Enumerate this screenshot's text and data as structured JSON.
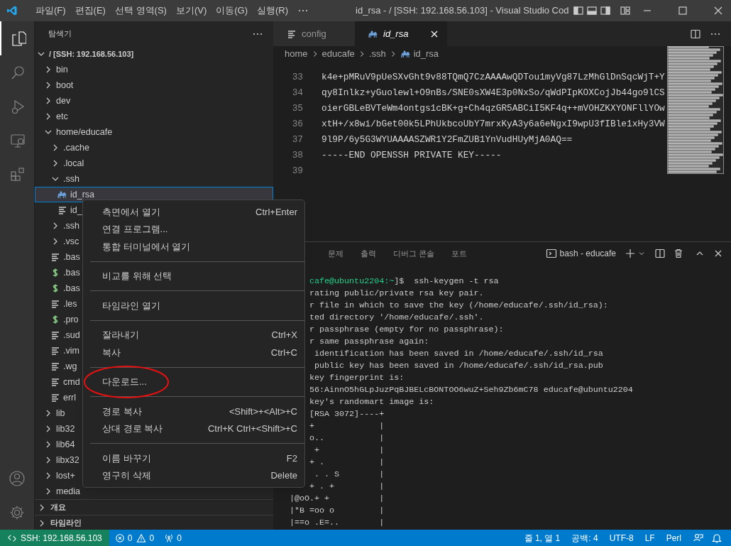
{
  "title_bar": {
    "menus": [
      "파일(F)",
      "편집(E)",
      "선택 영역(S)",
      "보기(V)",
      "이동(G)",
      "실행(R)"
    ],
    "title": "id_rsa - / [SSH: 192.168.56.103] - Visual Studio Cod"
  },
  "activity_bar": {
    "items": [
      {
        "kind": "explorer",
        "selected": true
      },
      {
        "kind": "search",
        "selected": false
      },
      {
        "kind": "run",
        "selected": false
      },
      {
        "kind": "remote",
        "selected": false
      },
      {
        "kind": "extensions",
        "selected": false
      }
    ]
  },
  "sidebar": {
    "title": "탐색기",
    "tree": [
      {
        "name": "/ [SSH: 192.168.56.103]",
        "kind": "root",
        "expanded": true,
        "selected": false,
        "children": [
          {
            "name": "bin",
            "kind": "folder",
            "expanded": false,
            "selected": false
          },
          {
            "name": "boot",
            "kind": "folder",
            "expanded": false,
            "selected": false
          },
          {
            "name": "dev",
            "kind": "folder",
            "expanded": false,
            "selected": false
          },
          {
            "name": "etc",
            "kind": "folder",
            "expanded": false,
            "selected": false
          },
          {
            "name": "home/educafe",
            "kind": "folder",
            "expanded": true,
            "selected": false,
            "children": [
              {
                "name": ".cache",
                "kind": "folder",
                "expanded": false,
                "selected": false
              },
              {
                "name": ".local",
                "kind": "folder",
                "expanded": false,
                "selected": false
              },
              {
                "name": ".ssh",
                "kind": "folder",
                "expanded": true,
                "selected": false,
                "children": [
                  {
                    "name": "id_rsa",
                    "kind": "key_file",
                    "selected": true
                  },
                  {
                    "name": "id_",
                    "kind": "text_file",
                    "selected": false
                  }
                ]
              },
              {
                "name": ".ssh",
                "kind": "folder",
                "expanded": false,
                "selected": false
              },
              {
                "name": ".vsc",
                "kind": "folder",
                "expanded": false,
                "selected": false
              },
              {
                "name": ".bas",
                "kind": "text_file",
                "selected": false
              },
              {
                "name": ".bas",
                "kind": "shell_file",
                "selected": false
              },
              {
                "name": ".bas",
                "kind": "shell_file",
                "selected": false
              },
              {
                "name": ".les",
                "kind": "text_file",
                "selected": false
              },
              {
                "name": ".pro",
                "kind": "shell_file",
                "selected": false
              },
              {
                "name": ".sud",
                "kind": "text_file",
                "selected": false
              },
              {
                "name": ".vim",
                "kind": "text_file",
                "selected": false
              },
              {
                "name": ".wg",
                "kind": "text_file",
                "selected": false
              },
              {
                "name": "cmd",
                "kind": "text_file",
                "selected": false
              },
              {
                "name": "errl",
                "kind": "text_file",
                "selected": false
              }
            ]
          },
          {
            "name": "lib",
            "kind": "folder",
            "expanded": false,
            "selected": false
          },
          {
            "name": "lib32",
            "kind": "folder",
            "expanded": false,
            "selected": false
          },
          {
            "name": "lib64",
            "kind": "folder",
            "expanded": false,
            "selected": false
          },
          {
            "name": "libx32",
            "kind": "folder",
            "expanded": false,
            "selected": false
          },
          {
            "name": "lost+",
            "kind": "folder",
            "expanded": false,
            "selected": false
          },
          {
            "name": "media",
            "kind": "folder",
            "expanded": false,
            "selected": false
          }
        ]
      }
    ],
    "sections": [
      {
        "label": "개요",
        "expanded": false
      },
      {
        "label": "타임라인",
        "expanded": false
      }
    ]
  },
  "editor": {
    "tabs": [
      {
        "label": "config",
        "kind": "text_file",
        "selected": false
      },
      {
        "label": "id_rsa",
        "kind": "key_file",
        "selected": true
      }
    ],
    "breadcrumb": [
      "home",
      "educafe",
      ".ssh",
      "id_rsa"
    ],
    "lines": [
      {
        "number": "33",
        "text": "k4e+pMRuV9pUeSXvGht9v88TQmQ7CzAAAAwQDTou1myVg87LzMhGlDnSqcWjT+Y"
      },
      {
        "number": "34",
        "text": "qy8Inlkz+yGuolewl+O9nBs/SNE0sXW4E3p0NxSo/qWdPIpKOXCojJb44go9lCS"
      },
      {
        "number": "35",
        "text": "oierGBLeBVTeWm4ontgs1cBK+g+Ch4qzGR5ABCiI5KF4q++mVOHZKXYONFllYOw"
      },
      {
        "number": "36",
        "text": "xtH+/x8wi/bGet00k5LPhUkbcoUbY7mrxKyA3y6a6eNgxI9wpU3fIBle1xHy3VW"
      },
      {
        "number": "37",
        "text": "9l9P/6y5G3WYUAAAASZWR1Y2FmZUB1YnVudHUyMjA0AQ=="
      },
      {
        "number": "38",
        "text": "-----END OPENSSH PRIVATE KEY-----"
      },
      {
        "number": "39"
      }
    ]
  },
  "panel": {
    "tabs": [
      {
        "label": "문제",
        "selected": false
      },
      {
        "label": "출력",
        "selected": false
      },
      {
        "label": "디버그 콘솔",
        "selected": false
      },
      {
        "label": "포트",
        "selected": false
      }
    ],
    "terminal_name": "bash - educafe",
    "terminal_lines_beside_menu": [
      {
        "prompt": "cafe@ubuntu2204:~",
        "text": "]$  ssh-keygen -t rsa"
      },
      {
        "text": "rating public/private rsa key pair."
      },
      {
        "text": "r file in which to save the key (/home/educafe/.ssh/id_rsa):"
      },
      {
        "text": "ted directory '/home/educafe/.ssh'."
      },
      {
        "text": "r passphrase (empty for no passphrase):"
      },
      {
        "text": "r same passphrase again:"
      },
      {
        "text": " identification has been saved in /home/educafe/.ssh/id_rsa"
      },
      {
        "text": " public key has been saved in /home/educafe/.ssh/id_rsa.pub"
      },
      {
        "text": "key fingerprint is:"
      },
      {
        "text": "56:AinnO5hGLpJuzPqBJBELcBONTOO6wuZ+Seh9Zb6mC78 educafe@ubuntu2204"
      },
      {
        "text": "key's randomart image is:"
      },
      {
        "text": "[RSA 3072]----+"
      },
      {
        "text": "+             |"
      },
      {
        "text": "o..           |"
      },
      {
        "text": " +            |"
      },
      {
        "text": "+ .           |"
      },
      {
        "text": " . . S        |"
      },
      {
        "text": "+ . +         |"
      }
    ],
    "terminal_lines": [
      {
        "text": "|@oO.+ +          |"
      },
      {
        "text": "|*B =oo o         |"
      },
      {
        "text": "|==o .E=..        |"
      }
    ]
  },
  "context_menu": {
    "items": [
      {
        "kind": "item",
        "label": "측면에서 열기",
        "shortcut": "Ctrl+Enter"
      },
      {
        "kind": "item",
        "label": "연결 프로그램..."
      },
      {
        "kind": "item",
        "label": "통합 터미널에서 열기"
      },
      {
        "kind": "separator"
      },
      {
        "kind": "item",
        "label": "비교를 위해 선택"
      },
      {
        "kind": "separator"
      },
      {
        "kind": "item",
        "label": "타임라인 열기"
      },
      {
        "kind": "separator"
      },
      {
        "kind": "item",
        "label": "잘라내기",
        "shortcut": "Ctrl+X"
      },
      {
        "kind": "item",
        "label": "복사",
        "shortcut": "Ctrl+C"
      },
      {
        "kind": "separator"
      },
      {
        "kind": "item",
        "label": "다운로드...",
        "circled": true
      },
      {
        "kind": "separator"
      },
      {
        "kind": "item",
        "label": "경로 복사",
        "shortcut": "<Shift>+<Alt>+C"
      },
      {
        "kind": "item",
        "label": "상대 경로 복사",
        "shortcut": "Ctrl+K Ctrl+<Shift>+C"
      },
      {
        "kind": "separator"
      },
      {
        "kind": "item",
        "label": "이름 바꾸기",
        "shortcut": "F2"
      },
      {
        "kind": "item",
        "label": "영구히 삭제",
        "shortcut": "Delete"
      }
    ]
  },
  "status_bar": {
    "remote": "SSH: 192.168.56.103",
    "errors": "0",
    "warnings": "0",
    "ports": "0",
    "items": [
      "줄 1, 열 1",
      "공백: 4",
      "UTF-8",
      "LF",
      "Perl"
    ]
  }
}
